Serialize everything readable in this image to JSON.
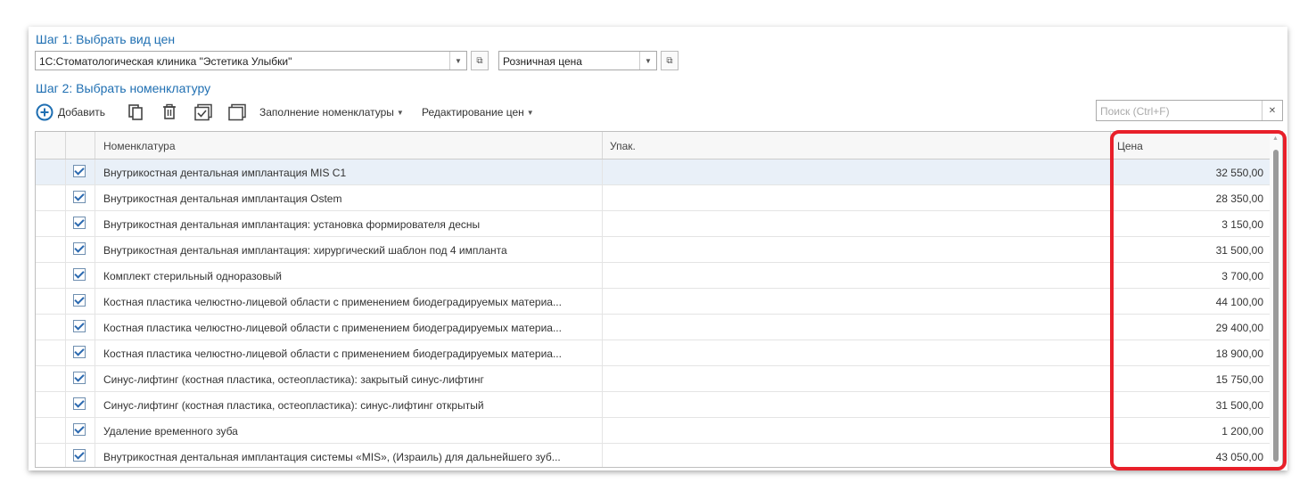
{
  "step1": {
    "title": "Шаг 1: Выбрать вид цен",
    "org": "1С:Стоматологическая клиника \"Эстетика Улыбки\"",
    "price_type": "Розничная цена"
  },
  "step2": {
    "title": "Шаг 2: Выбрать номенклатуру"
  },
  "toolbar": {
    "add_label": "Добавить",
    "fill_label": "Заполнение номенклатуры",
    "edit_prices_label": "Редактирование цен"
  },
  "search": {
    "placeholder": "Поиск (Ctrl+F)"
  },
  "table": {
    "columns": [
      "Номенклатура",
      "Упак.",
      "Цена"
    ],
    "rows": [
      {
        "checked": true,
        "name": "Внутрикостная дентальная имплантация MIS C1",
        "price": "32 550,00"
      },
      {
        "checked": true,
        "name": "Внутрикостная дентальная имплантация Ostem",
        "price": "28 350,00"
      },
      {
        "checked": true,
        "name": "Внутрикостная дентальная имплантация: установка формирователя десны",
        "price": "3 150,00"
      },
      {
        "checked": true,
        "name": "Внутрикостная дентальная имплантация: хирургический шаблон под 4 импланта",
        "price": "31 500,00"
      },
      {
        "checked": true,
        "name": "Комплект стерильный одноразовый",
        "price": "3 700,00"
      },
      {
        "checked": true,
        "name": "Костная пластика челюстно-лицевой области с применением биодеградируемых материа...",
        "price": "44 100,00"
      },
      {
        "checked": true,
        "name": "Костная пластика челюстно-лицевой области с применением биодеградируемых материа...",
        "price": "29 400,00"
      },
      {
        "checked": true,
        "name": "Костная пластика челюстно-лицевой области с применением биодеградируемых материа...",
        "price": "18 900,00"
      },
      {
        "checked": true,
        "name": "Синус-лифтинг (костная пластика, остеопластика): закрытый синус-лифтинг",
        "price": "15 750,00"
      },
      {
        "checked": true,
        "name": "Синус-лифтинг (костная пластика, остеопластика): синус-лифтинг открытый",
        "price": "31 500,00"
      },
      {
        "checked": true,
        "name": "Удаление временного зуба",
        "price": "1 200,00"
      },
      {
        "checked": true,
        "name": "Внутрикостная дентальная имплантация системы «MIS», (Израиль) для дальнейшего зуб...",
        "price": "43 050,00"
      }
    ]
  },
  "colors": {
    "accent": "#1f6fb2",
    "highlight": "#e8202a",
    "selected_row": "#e9f0f8"
  }
}
